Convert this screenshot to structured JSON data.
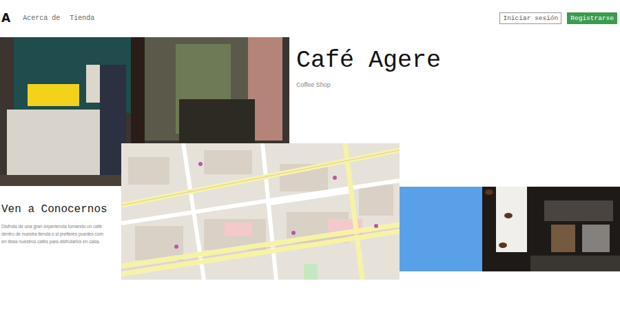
{
  "logo": "A",
  "nav": [
    {
      "label": "Acerca de"
    },
    {
      "label": "Tienda"
    }
  ],
  "auth": {
    "login": "Iniciar sesión",
    "register": "Registrarse"
  },
  "hero": {
    "title": "Café Agere",
    "subtitle": "Coffee Shop"
  },
  "about": {
    "title": "Ven a Conocernos",
    "lines": [
      "Disfruta de una gran experiencia tomando un café",
      "dentro de nuestra tienda o si prefieres puedes com",
      "en líbea nuestros cafés para disfrutarlos en casa."
    ]
  }
}
